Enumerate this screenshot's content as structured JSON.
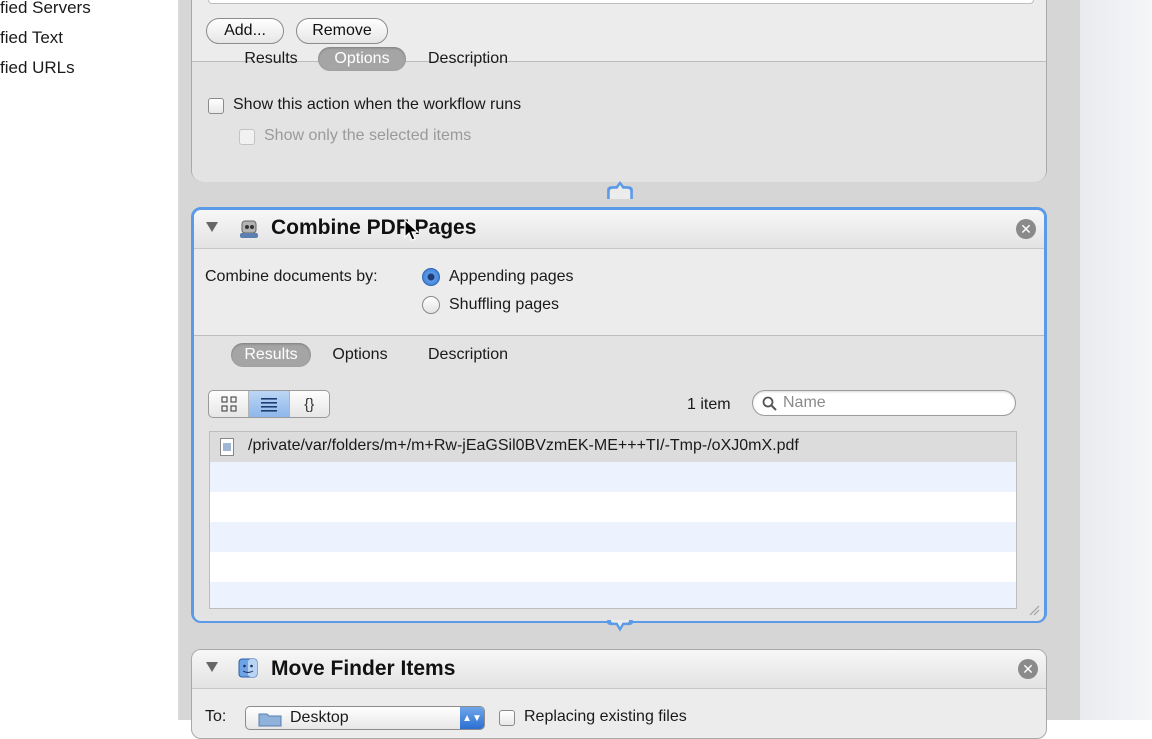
{
  "library": {
    "items": [
      "fied Servers",
      "fied Text",
      "fied URLs"
    ]
  },
  "prev_action": {
    "buttons": {
      "add": "Add...",
      "remove": "Remove"
    },
    "tabs": [
      "Results",
      "Options",
      "Description"
    ],
    "active_tab": "Options",
    "options": {
      "show_action": "Show this action when the workflow runs",
      "show_selected": "Show only the selected items"
    }
  },
  "combine_action": {
    "title": "Combine PDF Pages",
    "icon": "automator-robot-icon",
    "combine_label": "Combine documents by:",
    "radio_options": [
      "Appending pages",
      "Shuffling pages"
    ],
    "selected_option": "Appending pages",
    "tabs": [
      "Results",
      "Options",
      "Description"
    ],
    "active_tab": "Results",
    "view_modes": [
      "icon-view",
      "list-view",
      "code-view"
    ],
    "active_view": "list-view",
    "code_view_label": "{}",
    "item_count": "1 item",
    "search_placeholder": "Name",
    "results": [
      "/private/var/folders/m+/m+Rw-jEaGSil0BVzmEK-ME+++TI/-Tmp-/oXJ0mX.pdf"
    ]
  },
  "move_action": {
    "title": "Move Finder Items",
    "to_label": "To:",
    "destination": "Desktop",
    "replacing_label": "Replacing existing files"
  },
  "colors": {
    "selection_border": "#5b9ae6",
    "radio_accent": "#3b7fd9",
    "alt_row": "#edf3fe"
  }
}
